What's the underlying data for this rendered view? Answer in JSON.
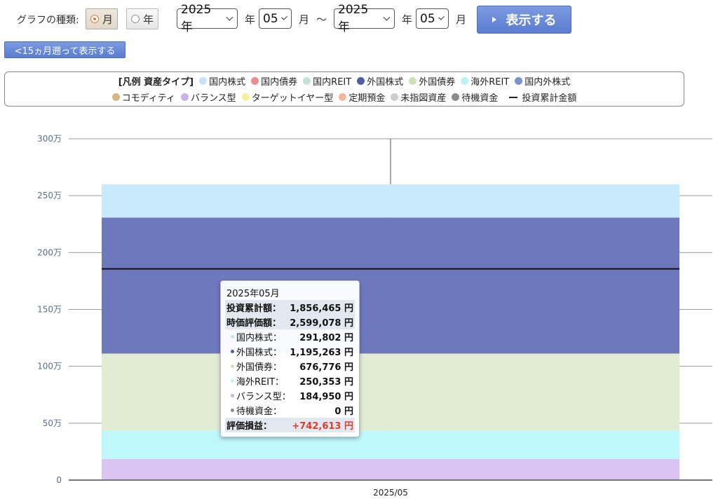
{
  "controls": {
    "graph_type_label": "グラフの種類:",
    "radio_month": "月",
    "radio_year": "年",
    "from_year": "2025 年",
    "from_year_unit": "年",
    "from_month": "05",
    "from_month_unit": "月",
    "range_sep": "〜",
    "to_year": "2025 年",
    "to_year_unit": "年",
    "to_month": "05",
    "to_month_unit": "月",
    "show_button": "表示する",
    "back_button": "<15ヵ月遡って表示する"
  },
  "legend": {
    "title": "[凡例 資産タイプ]",
    "row1": [
      {
        "name": "国内株式",
        "color": "#c6e2fb"
      },
      {
        "name": "国内債券",
        "color": "#f08b8b"
      },
      {
        "name": "国内REIT",
        "color": "#bfe3d6"
      },
      {
        "name": "外国株式",
        "color": "#4e5ea8"
      },
      {
        "name": "外国債券",
        "color": "#cfe0bb"
      },
      {
        "name": "海外REIT",
        "color": "#b8f3f5"
      },
      {
        "name": "国内外株式",
        "color": "#7c93c8"
      }
    ],
    "row2": [
      {
        "name": "コモディティ",
        "color": "#d2b883"
      },
      {
        "name": "バランス型",
        "color": "#c9b1ec"
      },
      {
        "name": "ターゲットイヤー型",
        "color": "#f7ef9a"
      },
      {
        "name": "定期預金",
        "color": "#f5b79c"
      },
      {
        "name": "未指図資産",
        "color": "#cccccc"
      },
      {
        "name": "待機資金",
        "color": "#8c8c8c"
      }
    ],
    "line_label": "投資累計金額"
  },
  "chart_data": {
    "type": "bar",
    "stacked": true,
    "categories": [
      "2025/05"
    ],
    "yticks": [
      "0",
      "50万",
      "100万",
      "150万",
      "200万",
      "250万",
      "300万"
    ],
    "ylim": [
      0,
      3000000
    ],
    "series": [
      {
        "name": "待機資金",
        "values": [
          0
        ],
        "color": "#8c8c8c"
      },
      {
        "name": "バランス型",
        "values": [
          184950
        ],
        "color": "#d9c4f2"
      },
      {
        "name": "海外REIT",
        "values": [
          250353
        ],
        "color": "#bff8fa"
      },
      {
        "name": "外国債券",
        "values": [
          676776
        ],
        "color": "#e1ecd3"
      },
      {
        "name": "外国株式",
        "values": [
          1195263
        ],
        "color": "#6e79bd"
      },
      {
        "name": "国内株式",
        "values": [
          291802
        ],
        "color": "#c9e9fc"
      }
    ],
    "line": {
      "name": "投資累計金額",
      "values": [
        1856465
      ],
      "color": "#111111"
    },
    "grid": true
  },
  "tooltip": {
    "title": "2025年05月",
    "invest_label": "投資累計額：",
    "invest_value": "1,856,465 円",
    "market_label": "時価評価額：",
    "market_value": "2,599,078 円",
    "items": [
      {
        "label": "国内株式：",
        "value": "291,802 円",
        "color": "#c6e2fb"
      },
      {
        "label": "外国株式：",
        "value": "1,195,263 円",
        "color": "#4e5ea8"
      },
      {
        "label": "外国債券：",
        "value": "676,776 円",
        "color": "#cfe0bb"
      },
      {
        "label": "海外REIT：",
        "value": "250,353 円",
        "color": "#b8f3f5"
      },
      {
        "label": "バランス型：",
        "value": "184,950 円",
        "color": "#c9b1ec"
      },
      {
        "label": "待機資金：",
        "value": "0 円",
        "color": "#8c8c8c"
      }
    ],
    "pl_label": "評価損益：",
    "pl_value": "+742,613 円"
  }
}
